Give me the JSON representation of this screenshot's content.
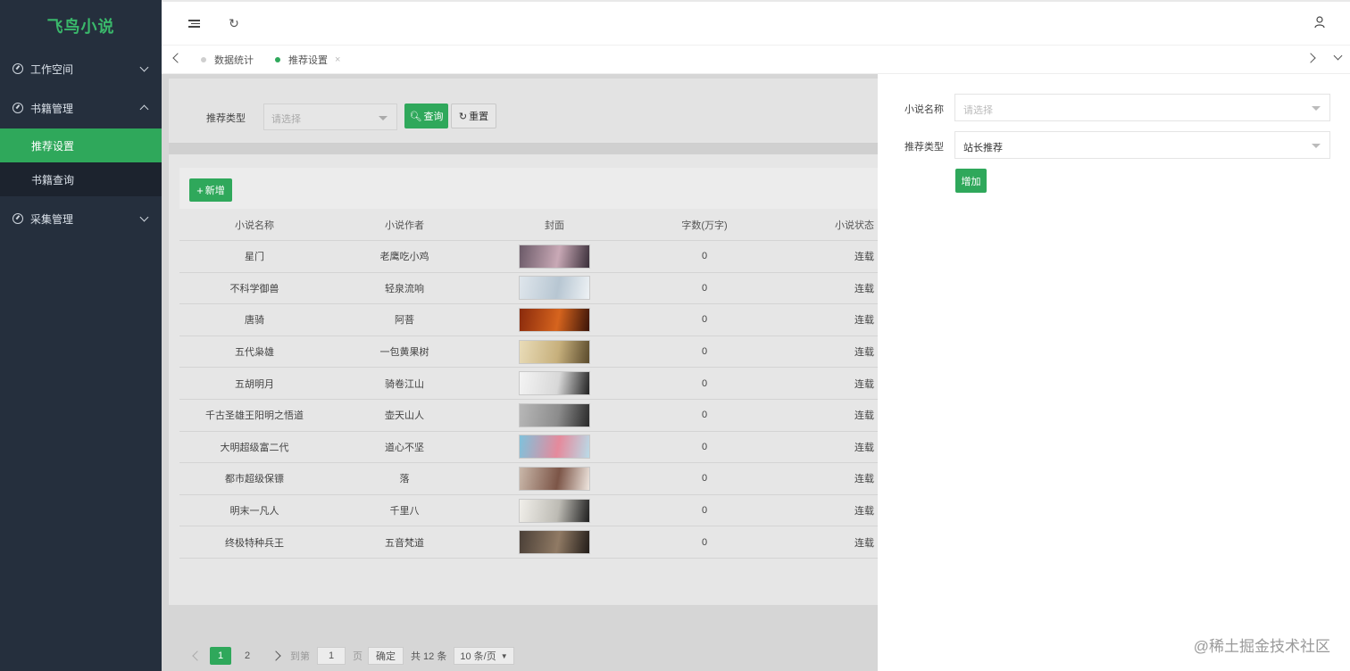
{
  "app": {
    "logo": "飞鸟小说"
  },
  "sidebar": {
    "groups": [
      {
        "label": "工作空间",
        "expanded": false
      },
      {
        "label": "书籍管理",
        "expanded": true,
        "children": [
          "推荐设置",
          "书籍查询"
        ],
        "active_child": "推荐设置"
      },
      {
        "label": "采集管理",
        "expanded": false
      }
    ]
  },
  "header": {
    "icons": [
      "menu-fold-icon",
      "refresh-icon",
      "user-icon"
    ]
  },
  "tabs": [
    {
      "label": "数据统计",
      "active": false
    },
    {
      "label": "推荐设置",
      "active": true,
      "closable": true,
      "close": "×"
    }
  ],
  "filter": {
    "type_label": "推荐类型",
    "type_placeholder": "请选择",
    "query_label": "查询",
    "reset_label": "重置"
  },
  "toolbar": {
    "add_label": "新增"
  },
  "table": {
    "columns": [
      "小说名称",
      "小说作者",
      "封面",
      "字数(万字)",
      "小说状态"
    ],
    "rows": [
      {
        "name": "星门",
        "author": "老鹰吃小鸡",
        "words": "0",
        "status": "连载",
        "cover_colors": [
          "#6b5a68",
          "#c9a9b6",
          "#3a2f3a"
        ]
      },
      {
        "name": "不科学御兽",
        "author": "轻泉流响",
        "words": "0",
        "status": "连载",
        "cover_colors": [
          "#dfe6ec",
          "#b7c6d2",
          "#eef2f5"
        ]
      },
      {
        "name": "唐骑",
        "author": "阿菩",
        "words": "0",
        "status": "连载",
        "cover_colors": [
          "#8a2a0c",
          "#d6641e",
          "#3b1408"
        ]
      },
      {
        "name": "五代枭雄",
        "author": "一包黄果树",
        "words": "0",
        "status": "连载",
        "cover_colors": [
          "#e9dcb8",
          "#c7b07c",
          "#5a4a2c"
        ]
      },
      {
        "name": "五胡明月",
        "author": "骑卷江山",
        "words": "0",
        "status": "连载",
        "cover_colors": [
          "#f4f4f4",
          "#d8d8d8",
          "#222222"
        ]
      },
      {
        "name": "千古圣雄王阳明之悟道",
        "author": "壶天山人",
        "words": "0",
        "status": "连载",
        "cover_colors": [
          "#b8b8b8",
          "#8c8c8c",
          "#2a2a2a"
        ]
      },
      {
        "name": "大明超级富二代",
        "author": "道心不坚",
        "words": "0",
        "status": "连载",
        "cover_colors": [
          "#7fc2dc",
          "#e58a9c",
          "#b9dbe8"
        ]
      },
      {
        "name": "都市超级保镖",
        "author": "落",
        "words": "0",
        "status": "连载",
        "cover_colors": [
          "#c9b7a9",
          "#7c5547",
          "#efe6df"
        ]
      },
      {
        "name": "明末一凡人",
        "author": "千里八",
        "words": "0",
        "status": "连载",
        "cover_colors": [
          "#f1efea",
          "#bdbbb4",
          "#1f1f1f"
        ]
      },
      {
        "name": "终极特种兵王",
        "author": "五音梵道",
        "words": "0",
        "status": "连载",
        "cover_colors": [
          "#4a3f37",
          "#907a64",
          "#231d19"
        ]
      }
    ]
  },
  "pagination": {
    "pages": [
      "1",
      "2"
    ],
    "current": "1",
    "goto_prefix": "到第",
    "goto_value": "1",
    "goto_suffix": "页",
    "confirm_label": "确定",
    "total_text": "共 12 条",
    "page_size": "10 条/页"
  },
  "drawer": {
    "name_label": "小说名称",
    "name_placeholder": "请选择",
    "type_label": "推荐类型",
    "type_value": "站长推荐",
    "submit_label": "增加"
  },
  "watermark": "@稀土掘金技术社区",
  "colors": {
    "primary": "#2fa85b",
    "sidebar_bg": "#252f3d",
    "logo": "#3ab86b"
  }
}
